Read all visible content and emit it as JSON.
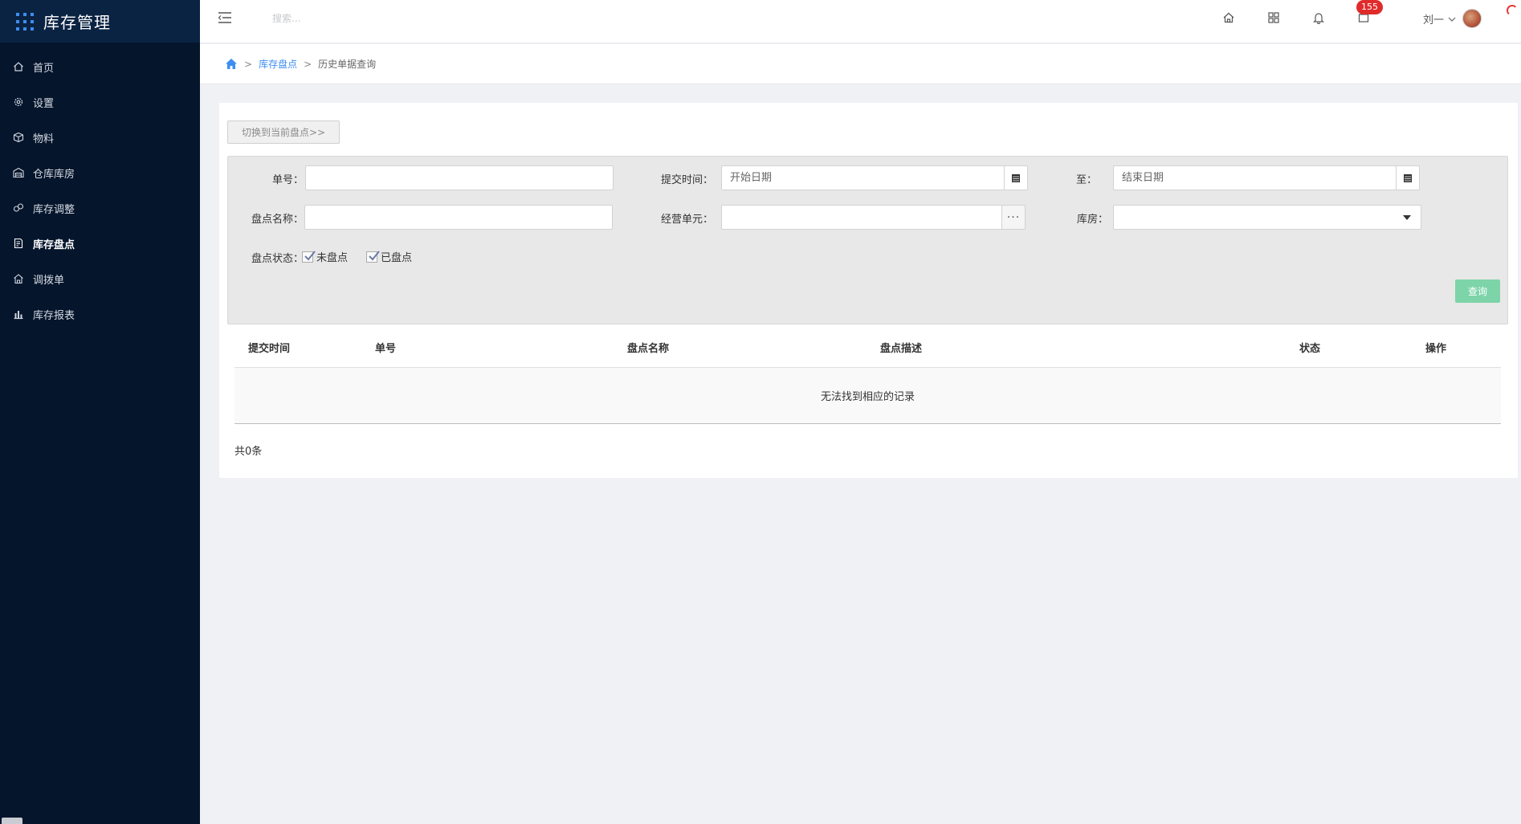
{
  "app": {
    "title": "库存管理"
  },
  "sidebar": {
    "items": [
      {
        "label": "首页",
        "icon": "home-icon"
      },
      {
        "label": "设置",
        "icon": "gear-icon"
      },
      {
        "label": "物料",
        "icon": "box-icon"
      },
      {
        "label": "仓库库房",
        "icon": "warehouse-icon"
      },
      {
        "label": "库存调整",
        "icon": "adjust-icon"
      },
      {
        "label": "库存盘点",
        "icon": "inventory-icon",
        "active": true
      },
      {
        "label": "调拨单",
        "icon": "transfer-icon"
      },
      {
        "label": "库存报表",
        "icon": "bar-chart-icon"
      }
    ]
  },
  "header": {
    "search_placeholder": "搜索...",
    "badge_count": "155",
    "user_name": "刘一"
  },
  "breadcrumb": {
    "parent": "库存盘点",
    "current": "历史单据查询",
    "separator": ">"
  },
  "toolbar": {
    "switch_label": "切换到当前盘点>>"
  },
  "filter": {
    "order_no_label": "单号：",
    "submit_time_label": "提交时间：",
    "start_date_placeholder": "开始日期",
    "to_label": "至：",
    "end_date_placeholder": "结束日期",
    "count_name_label": "盘点名称：",
    "business_unit_label": "经营单元：",
    "warehouse_label": "库房：",
    "status_label": "盘点状态：",
    "status_options": [
      {
        "label": "未盘点",
        "checked": true
      },
      {
        "label": "已盘点",
        "checked": true
      }
    ],
    "query_label": "查询",
    "dots": "···"
  },
  "table": {
    "columns": [
      "提交时间",
      "单号",
      "盘点名称",
      "盘点描述",
      "状态",
      "操作"
    ],
    "empty_text": "无法找到相应的记录",
    "total_text": "共0条"
  },
  "colors": {
    "sidebar_bg": "#05152c",
    "brand_bg": "#0a2343",
    "accent": "#3d8ef0",
    "query_button": "#7dd4a8",
    "badge": "#e02b2b"
  }
}
